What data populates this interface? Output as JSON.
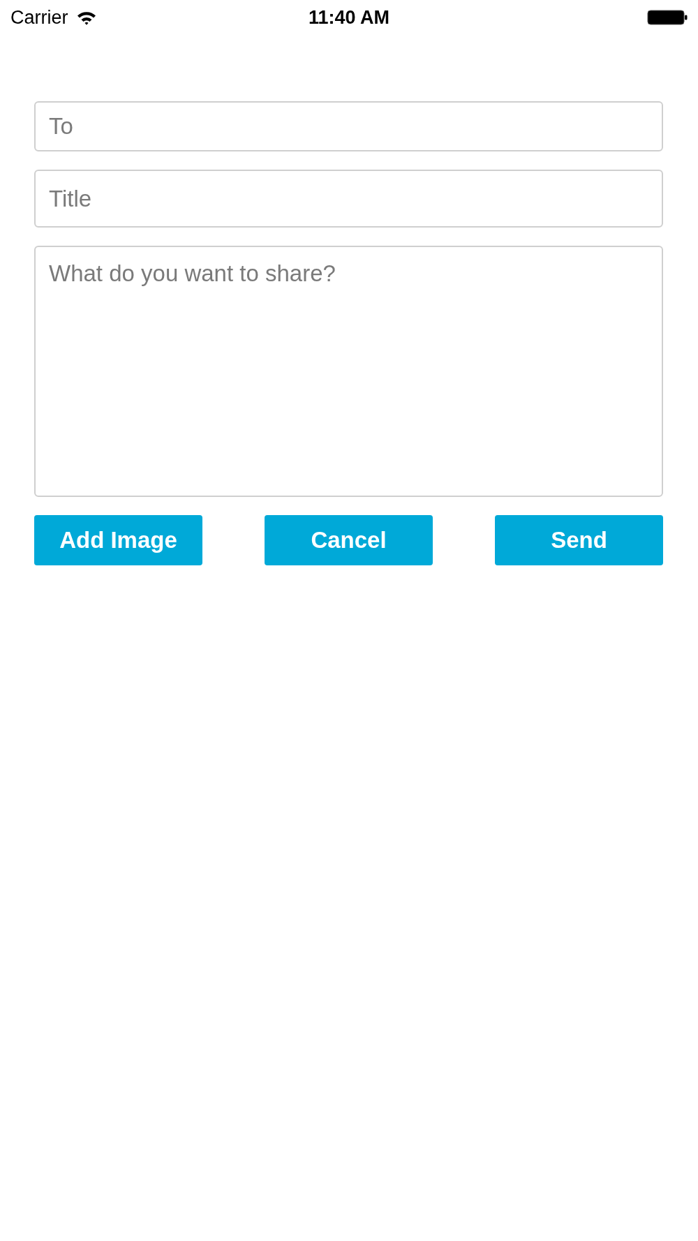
{
  "status_bar": {
    "carrier": "Carrier",
    "time": "11:40 AM"
  },
  "form": {
    "fields": [
      {
        "kind": "input",
        "placeholder": "To"
      },
      {
        "kind": "input",
        "placeholder": "Title"
      },
      {
        "kind": "textarea",
        "placeholder": "What do you want to share?"
      }
    ],
    "buttons": [
      {
        "label": "Add Image"
      },
      {
        "label": "Cancel"
      },
      {
        "label": "Send"
      }
    ]
  }
}
